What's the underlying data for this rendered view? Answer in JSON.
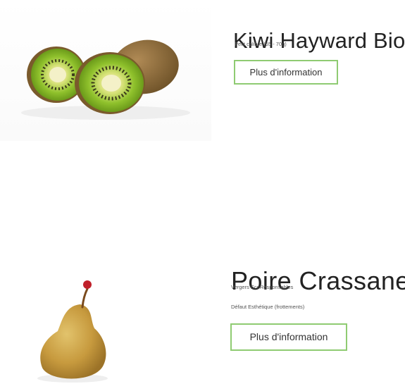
{
  "products": [
    {
      "name": "Kiwi Hayward Bio",
      "details": [
        "Petit calibre (65 - 70g)"
      ],
      "button_label": "Plus d'information",
      "image_icon": "kiwi-image"
    },
    {
      "name": "Poire Crassane",
      "details": [
        "Vergers EcoResponsables",
        "Défaut Esthétique (frottements)"
      ],
      "button_label": "Plus d'information",
      "image_icon": "pear-image"
    }
  ],
  "colors": {
    "button_border": "#8fcb72",
    "kiwi_flesh": "#9ac42e",
    "kiwi_skin": "#8a6a3a",
    "pear_skin": "#c9a14a",
    "pear_stem": "#c0202a"
  }
}
